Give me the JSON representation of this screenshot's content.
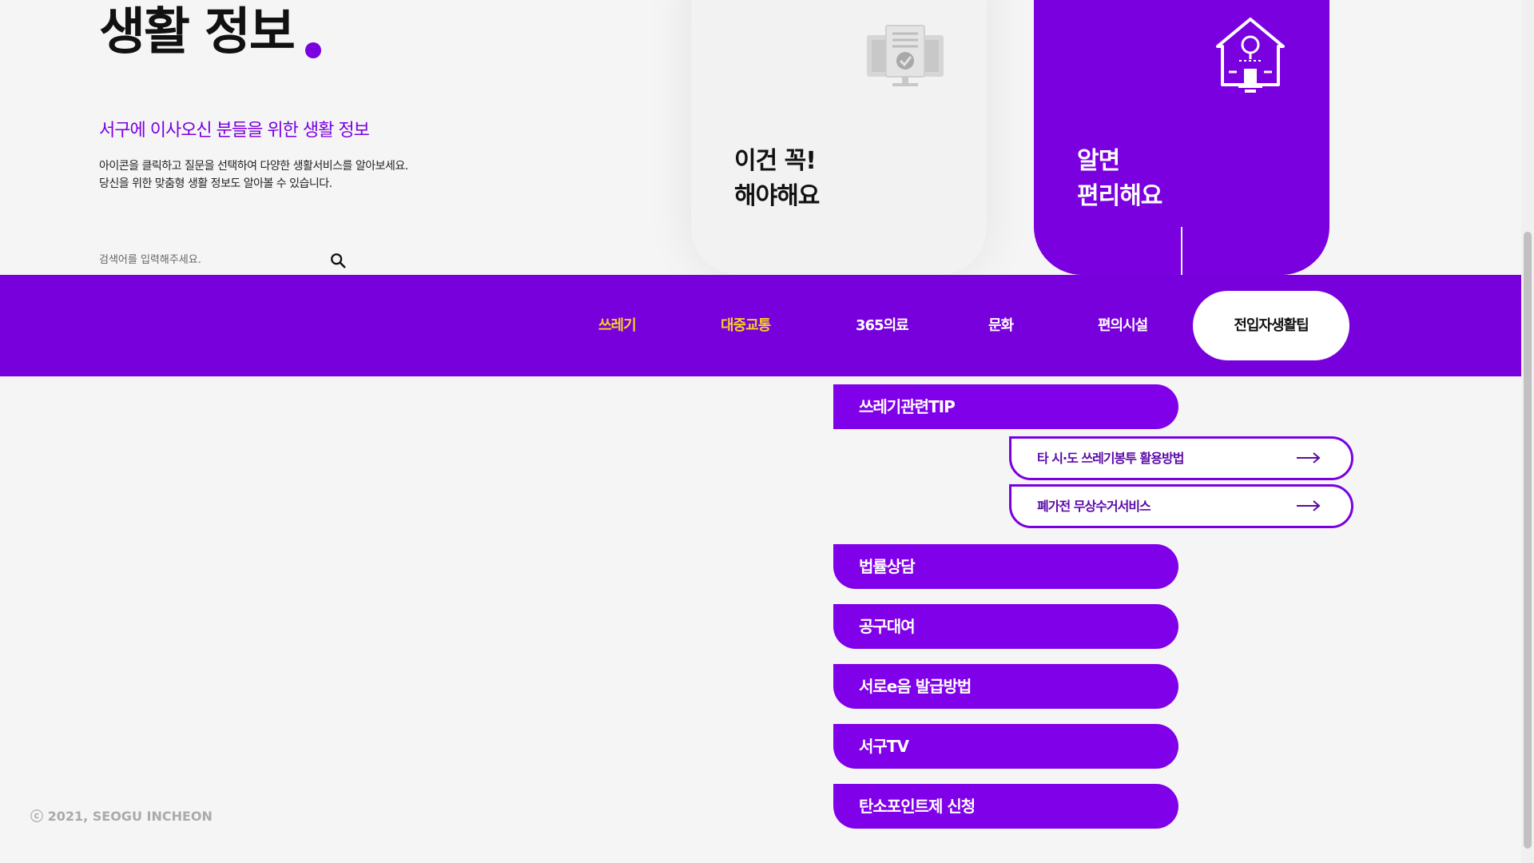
{
  "header": {
    "title": "생활 정보",
    "subtitle": "서구에 이사오신 분들을 위한 생활 정보",
    "description_line1": "아이콘을 클릭하고 질문을 선택하여 다양한 생활서비스를 알아보세요.",
    "description_line2": "당신을 위한 맞춤형 생활 정보도 알아볼 수 있습니다."
  },
  "search": {
    "placeholder": "검색어를 입력해주세요.",
    "icon": "search-icon"
  },
  "cards": {
    "must": {
      "line1": "이건 꼭!",
      "line2": "해야해요",
      "icon": "certificate-monitor-icon"
    },
    "tip": {
      "line1": "알면",
      "line2": "편리해요",
      "icon": "house-lightbulb-icon"
    }
  },
  "nav": {
    "items": [
      {
        "label": "쓰레기",
        "color": "#f5d020"
      },
      {
        "label": "대중교통",
        "color": "#f5d020"
      },
      {
        "label": "365의료",
        "color": "#ffffff"
      },
      {
        "label": "문화",
        "color": "#ffffff"
      },
      {
        "label": "편의시설",
        "color": "#ffffff"
      }
    ],
    "active": "전입자생활팁"
  },
  "menu": {
    "items": [
      "쓰레기관련TIP",
      "법률상담",
      "공구대여",
      "서로e음 발급방법",
      "서구TV",
      "탄소포인트제 신청"
    ],
    "sub_items": [
      "타 시·도 쓰레기봉투 활용방법",
      "폐가전 무상수거서비스"
    ]
  },
  "footer": {
    "copyright": "ⓒ 2021, SEOGU INCHEON"
  },
  "colors": {
    "accent": "#7a00e0",
    "nav_highlight": "#f5d020",
    "background": "#f5f5f5"
  }
}
